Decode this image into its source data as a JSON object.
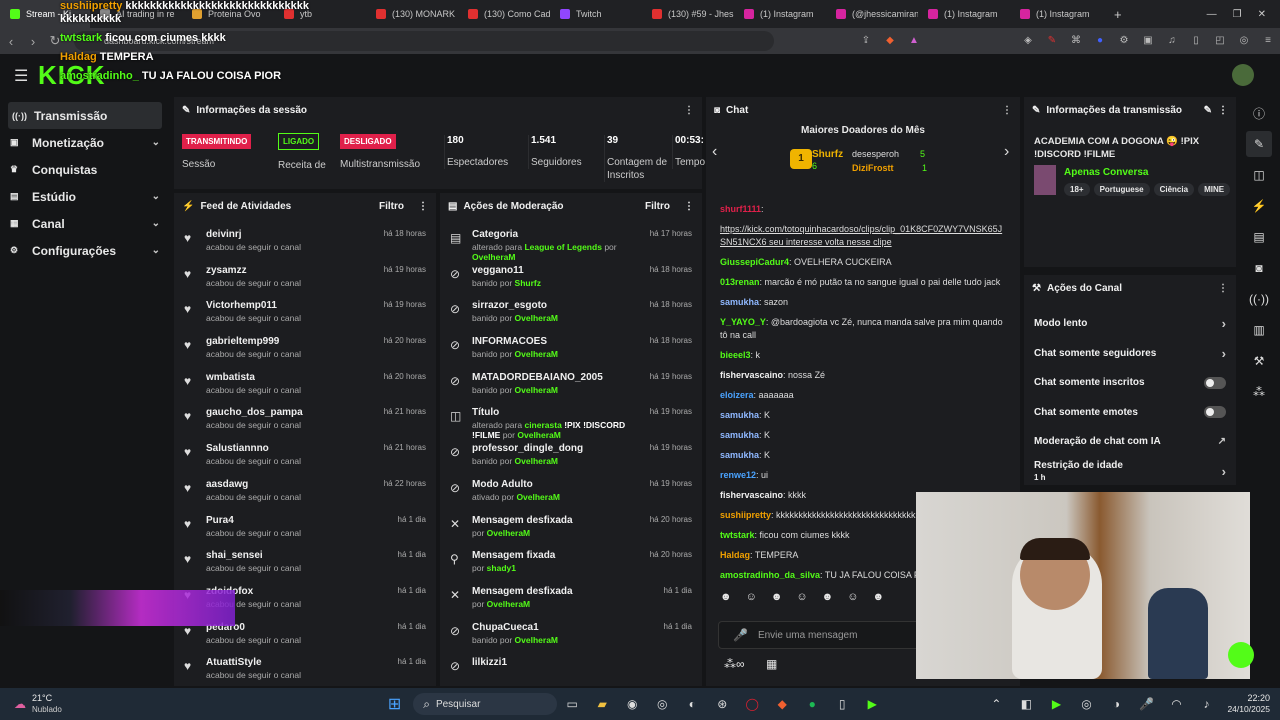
{
  "browser": {
    "tabs": [
      {
        "label": "Stream - Ki",
        "color": "#53fc18",
        "active": true
      },
      {
        "label": "AI trading in re",
        "color": "#888888"
      },
      {
        "label": "Proteina Ovo",
        "color": "#e0a030"
      },
      {
        "label": "ytb",
        "color": "#e03030"
      },
      {
        "label": "(130) MONARK",
        "color": "#e03030"
      },
      {
        "label": "(130) Como Cad",
        "color": "#e03030"
      },
      {
        "label": "Twitch",
        "color": "#9146ff"
      },
      {
        "label": "(130) #59 - Jhes",
        "color": "#e03030"
      },
      {
        "label": "(1) Instagram",
        "color": "#d6249f"
      },
      {
        "label": "(@jhessicamiran",
        "color": "#d6249f"
      },
      {
        "label": "(1) Instagram",
        "color": "#d6249f"
      },
      {
        "label": "(1) Instagram",
        "color": "#d6249f"
      }
    ],
    "new_tab": "+",
    "url": "dashboard.kick.com/stream"
  },
  "overlay_chat": [
    {
      "user": "sushiipretty",
      "text": "kkkkkkkkkkkkkkkkkkkkkkkkkkkkkk kkkkkkkkkk",
      "color": "#f0a000"
    },
    {
      "user": "twtstark",
      "text": "ficou com ciumes kkkk",
      "color": "#53fc18"
    },
    {
      "user": "Haldag",
      "text": "TEMPERA",
      "color": "#f0a000"
    },
    {
      "user": "amostradinho_",
      "text": "TU JA FALOU COISA PIOR",
      "color": "#53fc18"
    }
  ],
  "sidebar": {
    "items": [
      {
        "label": "Transmissão",
        "icon": "broadcast-icon",
        "active": true
      },
      {
        "label": "Monetização",
        "icon": "money-icon",
        "chev": true
      },
      {
        "label": "Conquistas",
        "icon": "trophy-icon"
      },
      {
        "label": "Estúdio",
        "icon": "studio-icon",
        "chev": true
      },
      {
        "label": "Canal",
        "icon": "channel-icon",
        "chev": true
      },
      {
        "label": "Configurações",
        "icon": "gear-icon",
        "chev": true
      }
    ]
  },
  "session": {
    "title": "Informações da sessão",
    "badges": [
      {
        "text": "TRANSMITINDO",
        "label": "Sessão",
        "color": "#e0204a"
      },
      {
        "text": "LIGADO",
        "label": "Receita de",
        "color": "#53fc18"
      },
      {
        "text": "DESLIGADO",
        "label": "Multistransmissão",
        "color": "#e0204a"
      }
    ],
    "stats": [
      {
        "value": "180",
        "label": "Espectadores"
      },
      {
        "value": "1.541",
        "label": "Seguidores"
      },
      {
        "value": "39",
        "label": "Contagem de Inscritos"
      },
      {
        "value": "00:53:",
        "label": "Tempo Ao Vivo"
      }
    ]
  },
  "feed": {
    "title": "Feed de Atividades",
    "filter": "Filtro",
    "rows": [
      {
        "name": "deivinrj",
        "sub": "acabou de seguir o canal",
        "time": "há 18 horas"
      },
      {
        "name": "zysamzz",
        "sub": "acabou de seguir o canal",
        "time": "há 19 horas"
      },
      {
        "name": "Victorhemp011",
        "sub": "acabou de seguir o canal",
        "time": "há 19 horas"
      },
      {
        "name": "gabrieltemp999",
        "sub": "acabou de seguir o canal",
        "time": "há 20 horas"
      },
      {
        "name": "wmbatista",
        "sub": "acabou de seguir o canal",
        "time": "há 20 horas"
      },
      {
        "name": "gaucho_dos_pampa",
        "sub": "acabou de seguir o canal",
        "time": "há 21 horas"
      },
      {
        "name": "Salustiannno",
        "sub": "acabou de seguir o canal",
        "time": "há 21 horas"
      },
      {
        "name": "aasdawg",
        "sub": "acabou de seguir o canal",
        "time": "há 22 horas"
      },
      {
        "name": "Pura4",
        "sub": "acabou de seguir o canal",
        "time": "há 1 dia"
      },
      {
        "name": "shai_sensei",
        "sub": "acabou de seguir o canal",
        "time": "há 1 dia"
      },
      {
        "name": "zdoidofox",
        "sub": "acabou de seguir o canal",
        "time": "há 1 dia"
      },
      {
        "name": "pedaro0",
        "sub": "acabou de seguir o canal",
        "time": "há 1 dia"
      },
      {
        "name": "AtuattiStyle",
        "sub": "acabou de seguir o canal",
        "time": "há 1 dia"
      }
    ]
  },
  "moderation": {
    "title": "Ações de Moderação",
    "filter": "Filtro",
    "rows": [
      {
        "name": "Categoria",
        "pre": "alterado para",
        "obj": "League of Legends",
        "mid": "por",
        "by": "OvelheraM",
        "time": "há 17 horas",
        "icon": "category-icon"
      },
      {
        "name": "veggano11",
        "pre": "banido por",
        "by": "Shurfz",
        "time": "há 18 horas",
        "icon": "ban-icon"
      },
      {
        "name": "sirrazor_esgoto",
        "pre": "banido por",
        "by": "OvelheraM",
        "time": "há 18 horas",
        "icon": "ban-icon"
      },
      {
        "name": "INFORMACOES",
        "pre": "banido por",
        "by": "OvelheraM",
        "time": "há 18 horas",
        "icon": "ban-icon"
      },
      {
        "name": "MATADORDEBAIANO_2005",
        "pre": "banido por",
        "by": "OvelheraM",
        "time": "há 19 horas",
        "icon": "ban-icon"
      },
      {
        "name": "Título",
        "pre": "alterado para",
        "obj": "cinerasta",
        "post": "!PIX !DISCORD !FILME",
        "mid": "por",
        "by": "OvelheraM",
        "time": "há 19 horas",
        "icon": "title-icon"
      },
      {
        "name": "professor_dingle_dong",
        "pre": "banido por",
        "by": "OvelheraM",
        "time": "há 19 horas",
        "icon": "ban-icon"
      },
      {
        "name": "Modo Adulto",
        "pre": "ativado por",
        "by": "OvelheraM",
        "time": "há 19 horas",
        "icon": "adult-icon"
      },
      {
        "name": "Mensagem desfixada",
        "pre": "por",
        "by": "OvelheraM",
        "time": "há 20 horas",
        "icon": "unpin-icon"
      },
      {
        "name": "Mensagem fixada",
        "pre": "por",
        "by": "shady1",
        "time": "há 20 horas",
        "icon": "pin-icon"
      },
      {
        "name": "Mensagem desfixada",
        "pre": "por",
        "by": "OvelheraM",
        "time": "há 1 dia",
        "icon": "unpin-icon"
      },
      {
        "name": "ChupaCueca1",
        "pre": "banido por",
        "by": "OvelheraM",
        "time": "há 1 dia",
        "icon": "ban-icon"
      },
      {
        "name": "lilkizzi1",
        "pre": "",
        "by": "",
        "time": "",
        "icon": "ban-icon"
      }
    ]
  },
  "chat": {
    "title": "Chat",
    "donors_title": "Maiores Doadores do Mês",
    "donors": [
      {
        "name": "Shurfz",
        "amount": "6",
        "rank": "1"
      },
      {
        "name": "desesperoh",
        "amount": "5"
      },
      {
        "name": "DiziFrostt",
        "amount": "1"
      }
    ],
    "messages": [
      {
        "user": "shurf1111",
        "text": "",
        "color": "#e0204a"
      },
      {
        "user": "",
        "text": "https://kick.com/totoquinhacardoso/clips/clip_01K8CF0ZWY7VNSK65JSN51NCX6 seu interesse volta nesse clipe",
        "color": "#ddd"
      },
      {
        "user": "GiussepiCadur4",
        "text": "OVELHERA CUCKEIRA",
        "color": "#53fc18"
      },
      {
        "user": "013renan",
        "text": "marcão é mó putão ta no sangue igual o pai delle tudo jack",
        "color": "#53fc18"
      },
      {
        "user": "samukha",
        "text": "sazon",
        "color": "#8fb8ff"
      },
      {
        "user": "Y_YAYO_Y",
        "text": "@bardoagiota vc Zé, nunca manda salve pra mim quando tô na call",
        "color": "#53fc18"
      },
      {
        "user": "bieeel3",
        "text": "k",
        "color": "#53fc18"
      },
      {
        "user": "fishervascaino",
        "text": "nossa Zé",
        "color": "#f0f0f0"
      },
      {
        "user": "eloizera",
        "text": "aaaaaaa",
        "color": "#4aa3ff"
      },
      {
        "user": "samukha",
        "text": "K",
        "color": "#8fb8ff"
      },
      {
        "user": "samukha",
        "text": "K",
        "color": "#8fb8ff"
      },
      {
        "user": "samukha",
        "text": "K",
        "color": "#8fb8ff"
      },
      {
        "user": "renwe12",
        "text": "ui",
        "color": "#4aa3ff"
      },
      {
        "user": "fishervascaino",
        "text": "kkkk",
        "color": "#f0f0f0"
      },
      {
        "user": "sushiipretty",
        "text": "kkkkkkkkkkkkkkkkkkkkkkkkkkkkkkk",
        "color": "#f0a000"
      },
      {
        "user": "twtstark",
        "text": "ficou com ciumes kkkk",
        "color": "#53fc18"
      },
      {
        "user": "Haldag",
        "text": "TEMPERA",
        "color": "#f0a000"
      },
      {
        "user": "amostradinho_da_silva",
        "text": "TU JA FALOU COISA PI",
        "color": "#53fc18"
      }
    ],
    "input_placeholder": "Envie uma mensagem"
  },
  "stream_info": {
    "title": "Informações da transmissão",
    "stream_title": "ACADEMIA COM A DOGONA 😜 !PIX !DISCORD !FILME",
    "category": "Apenas Conversa",
    "tags": [
      "18+",
      "Portuguese",
      "Ciência",
      "MINE"
    ]
  },
  "channel_actions": {
    "title": "Ações do Canal",
    "items": [
      {
        "label": "Modo lento",
        "type": "chevron"
      },
      {
        "label": "Chat somente seguidores",
        "type": "chevron"
      },
      {
        "label": "Chat somente inscritos",
        "type": "toggle"
      },
      {
        "label": "Chat somente emotes",
        "type": "toggle"
      },
      {
        "label": "Moderação de chat com IA",
        "type": "link"
      },
      {
        "label": "Restrição de idade",
        "sub": "1 h",
        "type": "chevron"
      }
    ]
  },
  "taskbar": {
    "weather_temp": "21°C",
    "weather_desc": "Nublado",
    "search": "Pesquisar",
    "time": "22:20",
    "date": "24/10/2025"
  },
  "logo": "KICK"
}
